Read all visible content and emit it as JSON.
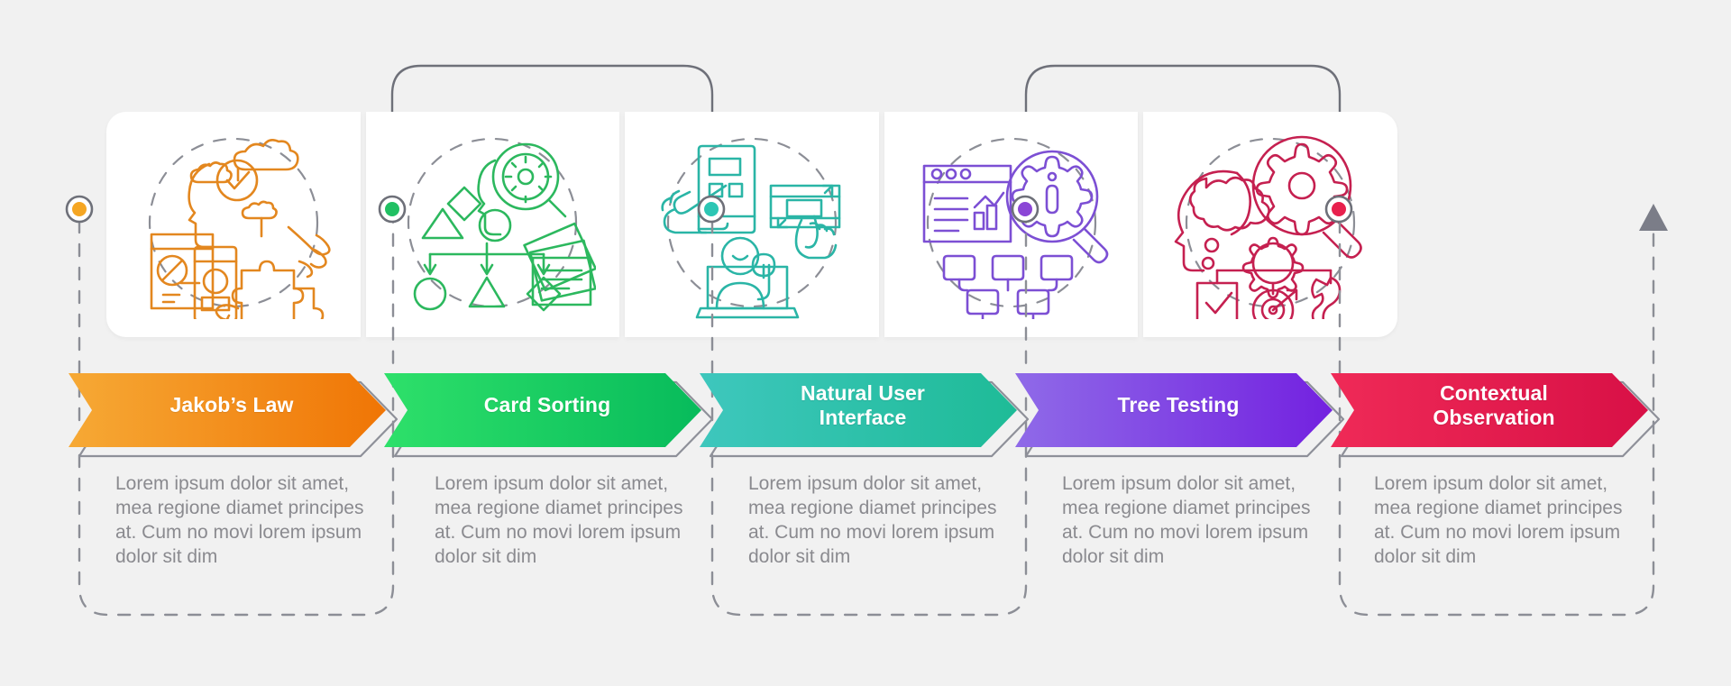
{
  "meta": {
    "background_color": "#f1f1f1",
    "card_color": "#ffffff",
    "connector_color": "#6e7079",
    "dashed_color": "#8c8e96",
    "body_text_color": "#8a8a8f"
  },
  "steps": [
    {
      "id": "jakobs-law",
      "label": "Jakob’s Law",
      "description": "Lorem ipsum dolor sit amet, mea regione diamet principes at. Cum no movi lorem ipsum dolor sit dim",
      "icon_name": "usability-puzzle-icon",
      "color_start": "#f6a935",
      "color_end": "#f07505",
      "dot_color": "#f5a623",
      "icon_color": "#e3871f"
    },
    {
      "id": "card-sorting",
      "label": "Card Sorting",
      "description": "Lorem ipsum dolor sit amet, mea regione diamet principes at. Cum no movi lorem ipsum dolor sit dim",
      "icon_name": "card-sorting-shapes-icon",
      "color_start": "#2ee06a",
      "color_end": "#07bb5b",
      "dot_color": "#21c063",
      "icon_color": "#2cb85e"
    },
    {
      "id": "natural-user-interface",
      "label": "Natural User Interface",
      "description": "Lorem ipsum dolor sit amet, mea regione diamet principes at. Cum no movi lorem ipsum dolor sit dim",
      "icon_name": "touch-gesture-icon",
      "color_start": "#3ec7bd",
      "color_end": "#1ebb97",
      "dot_color": "#2cc6b4",
      "icon_color": "#2ab5a6"
    },
    {
      "id": "tree-testing",
      "label": "Tree Testing",
      "description": "Lorem ipsum dolor sit amet, mea regione diamet principes at. Cum no movi lorem ipsum dolor sit dim",
      "icon_name": "site-hierarchy-analysis-icon",
      "color_start": "#8f6ae8",
      "color_end": "#7321e0",
      "dot_color": "#8b46d6",
      "icon_color": "#7c4fd4"
    },
    {
      "id": "contextual-observation",
      "label": "Contextual Observation",
      "description": "Lorem ipsum dolor sit amet, mea regione diamet principes at. Cum no movi lorem ipsum dolor sit dim",
      "icon_name": "research-goal-icon",
      "color_start": "#ef2a57",
      "color_end": "#d81046",
      "dot_color": "#e8204d",
      "icon_color": "#c52050"
    }
  ],
  "end_marker": {
    "icon_name": "triangle-up-arrow-icon",
    "color": "#7b7d88"
  }
}
